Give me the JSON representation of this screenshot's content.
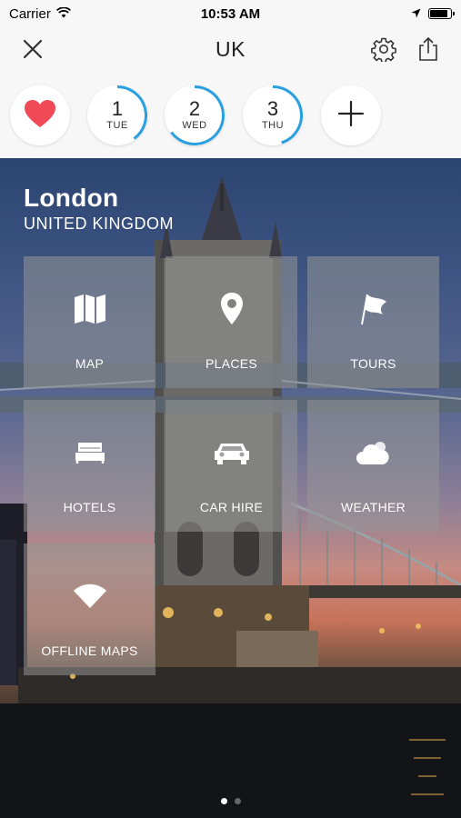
{
  "status_bar": {
    "carrier": "Carrier",
    "time": "10:53 AM",
    "battery_level": 0.95
  },
  "nav": {
    "title": "UK",
    "close_icon": "close-icon",
    "settings_icon": "gear-icon",
    "share_icon": "share-icon"
  },
  "days": [
    {
      "num": "1",
      "name": "TUE",
      "progress": 0.4
    },
    {
      "num": "2",
      "name": "WED",
      "progress": 0.65
    },
    {
      "num": "3",
      "name": "THU",
      "progress": 0.45
    }
  ],
  "day_strip": {
    "favorite_icon": "heart-icon",
    "add_icon": "plus-icon",
    "accent_color": "#2a9fe0",
    "heart_color": "#ef4a56"
  },
  "destination": {
    "city": "London",
    "country": "UNITED KINGDOM"
  },
  "tiles": [
    {
      "label": "MAP",
      "icon": "map-icon"
    },
    {
      "label": "PLACES",
      "icon": "pin-icon"
    },
    {
      "label": "TOURS",
      "icon": "flag-icon"
    },
    {
      "label": "HOTELS",
      "icon": "bed-icon"
    },
    {
      "label": "CAR HIRE",
      "icon": "car-icon"
    },
    {
      "label": "WEATHER",
      "icon": "weather-icon"
    },
    {
      "label": "OFFLINE MAPS",
      "icon": "wifi-icon"
    }
  ],
  "pager": {
    "pages": 2,
    "current": 1
  }
}
